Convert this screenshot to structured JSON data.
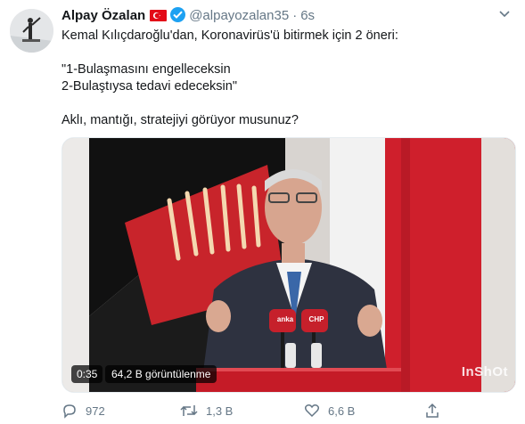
{
  "user": {
    "name": "Alpay Özalan",
    "handle": "@alpayozalan35",
    "separator": "·",
    "time": "6s"
  },
  "tweet": {
    "text": "Kemal Kılıçdaroğlu'dan, Koronavirüs'ü bitirmek için 2 öneri:\n\n\"1-Bulaşmasını engelleceksin\n  2-Bulaştıysa tedavi edeceksin\"\n\nAklı, mantığı, stratejiyi görüyor musunuz?"
  },
  "media": {
    "duration": "0:35",
    "views": "64,2 B görüntülenme",
    "watermark": "InShOt",
    "mic_label_left": "anka",
    "mic_label_right": "CHP"
  },
  "actions": {
    "reply_count": "972",
    "retweet_count": "1,3 B",
    "like_count": "6,6 B"
  },
  "colors": {
    "verified": "#1da1f2",
    "flag": "#e30a17",
    "muted": "#657786"
  }
}
